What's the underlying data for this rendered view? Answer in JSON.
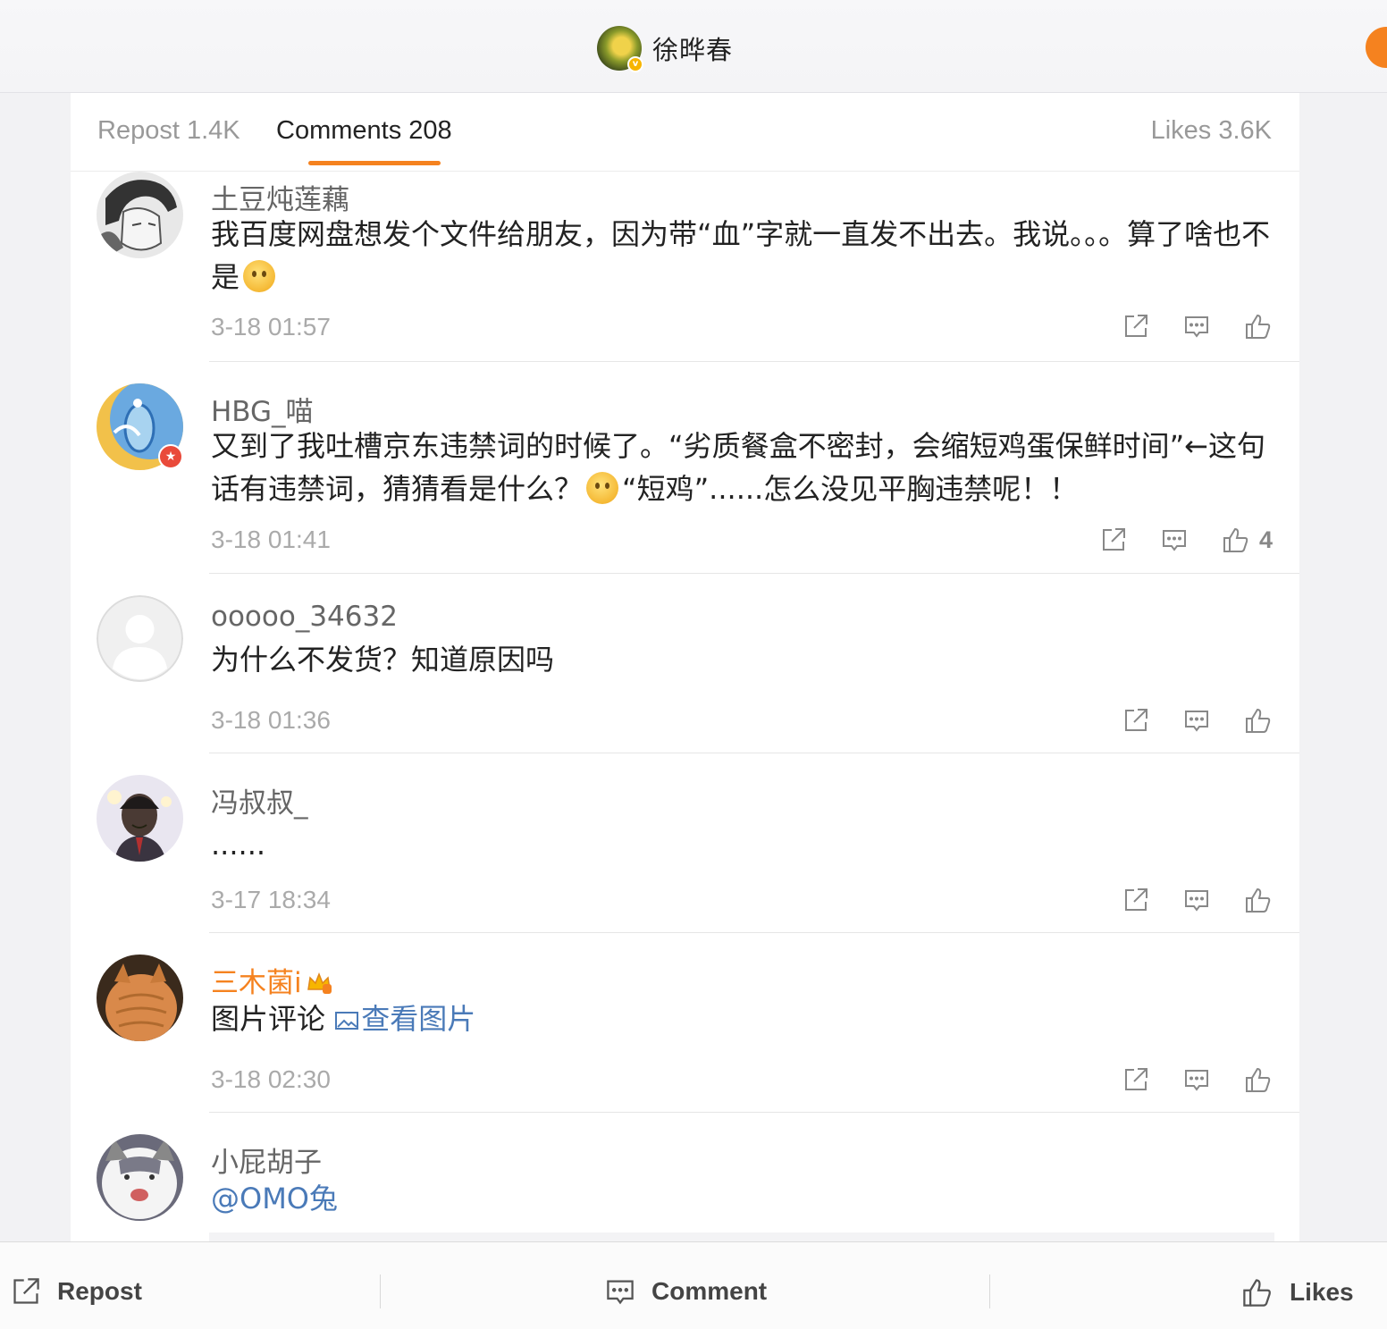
{
  "header": {
    "author_name": "徐晔春",
    "verified_badge": "v"
  },
  "tabs": {
    "repost": "Repost 1.4K",
    "comments": "Comments 208",
    "likes": "Likes 3.6K",
    "active": "comments"
  },
  "comments": [
    {
      "username": "土豆炖莲藕",
      "text_before_emoji": "我百度网盘想发个文件给朋友，因为带“血”字就一直发不出去。我说。。。算了啥也不是",
      "emoji": "smile-emoji",
      "time": "3-18 01:57",
      "likes": ""
    },
    {
      "username": "HBG_喵",
      "text_before_emoji": "又到了我吐槽京东违禁词的时候了。“劣质餐盒不密封，会缩短鸡蛋保鲜时间”←这句话有违禁词，猜猜看是什么？",
      "emoji": "grin-emoji",
      "text_after_emoji": "“短鸡”......怎么没见平胸违禁呢！！",
      "time": "3-18 01:41",
      "likes": "4"
    },
    {
      "username": "ooooo_34632",
      "text": "为什么不发货？知道原因吗",
      "time": "3-18 01:36",
      "likes": ""
    },
    {
      "username": "冯叔叔_",
      "text": "......",
      "time": "3-17 18:34",
      "likes": ""
    },
    {
      "username": "三木菌i",
      "text": "图片评论",
      "link": "查看图片",
      "time": "3-18 02:30",
      "likes": ""
    },
    {
      "username": "小屁胡子",
      "mention": "@OMO兔"
    }
  ],
  "bottombar": {
    "repost": "Repost",
    "comment": "Comment",
    "likes": "Likes"
  },
  "colors": {
    "accent": "#f5821f",
    "link": "#4a7ab8",
    "vip_name": "#f5821f"
  }
}
